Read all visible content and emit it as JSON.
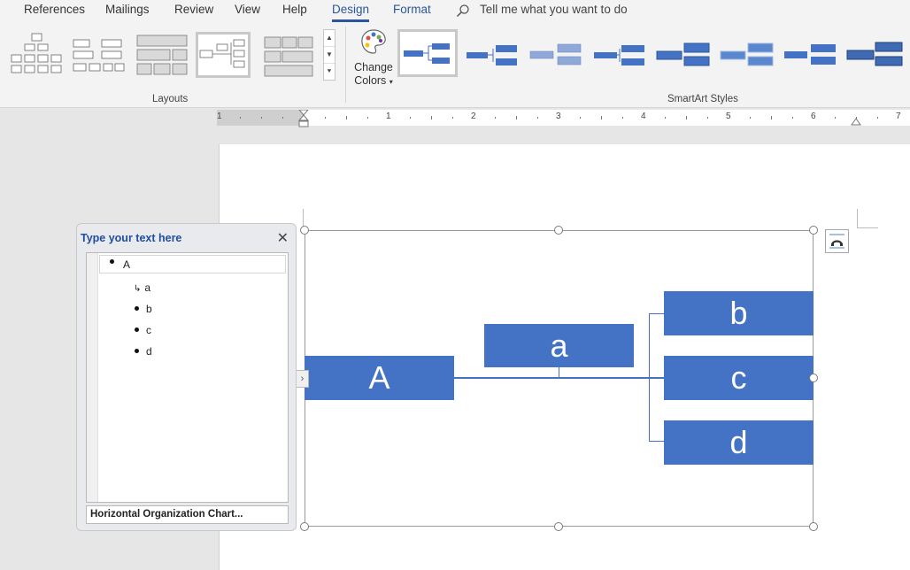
{
  "ribbon": {
    "tabs": [
      {
        "label": "References"
      },
      {
        "label": "Mailings"
      },
      {
        "label": "Review"
      },
      {
        "label": "View"
      },
      {
        "label": "Help"
      },
      {
        "label": "Design"
      },
      {
        "label": "Format"
      }
    ],
    "active_tab": "Design",
    "tell_me": "Tell me what you want to do",
    "groups": {
      "layouts_label": "Layouts",
      "styles_label": "SmartArt Styles"
    },
    "change_colors": {
      "line1": "Change",
      "line2": "Colors"
    },
    "accent_color": "#2b579a"
  },
  "ruler": {
    "numbers": [
      "1",
      "1",
      "2",
      "3",
      "4",
      "5",
      "6",
      "7"
    ]
  },
  "text_pane": {
    "title": "Type your text here",
    "items": [
      {
        "level": 0,
        "text": "A"
      },
      {
        "level": 1,
        "text": "a",
        "assistant": true
      },
      {
        "level": 1,
        "text": "b"
      },
      {
        "level": 1,
        "text": "c"
      },
      {
        "level": 1,
        "text": "d"
      }
    ],
    "layout_name": "Horizontal Organization Chart..."
  },
  "smartart": {
    "node_color": "#4472c4",
    "root": "A",
    "assistant": "a",
    "children": [
      "b",
      "c",
      "d"
    ]
  }
}
